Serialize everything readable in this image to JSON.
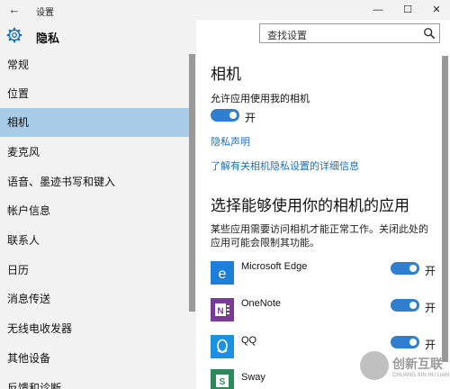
{
  "window": {
    "title": "设置",
    "back_glyph": "←",
    "min_glyph": "—",
    "max_glyph": "☐",
    "close_glyph": "✕"
  },
  "sidebar": {
    "title": "隐私",
    "items": [
      {
        "label": "常规"
      },
      {
        "label": "位置"
      },
      {
        "label": "相机"
      },
      {
        "label": "麦克风"
      },
      {
        "label": "语音、墨迹书写和键入"
      },
      {
        "label": "帐户信息"
      },
      {
        "label": "联系人"
      },
      {
        "label": "日历"
      },
      {
        "label": "消息传送"
      },
      {
        "label": "无线电收发器"
      },
      {
        "label": "其他设备"
      },
      {
        "label": "反馈和诊断"
      }
    ],
    "selected_index": 2
  },
  "search": {
    "placeholder": "查找设置"
  },
  "main": {
    "title": "相机",
    "allow_label": "允许应用使用我的相机",
    "allow_state": "开",
    "privacy_link": "隐私声明",
    "learn_more_link": "了解有关相机隐私设置的详细信息",
    "section_title": "选择能够使用你的相机的应用",
    "section_desc": "某些应用需要访问相机才能正常工作。关闭此处的应用可能会限制其功能。",
    "apps": [
      {
        "name": "Microsoft Edge",
        "state": "开",
        "icon": "edge-icon",
        "color": "#1e7fd8"
      },
      {
        "name": "OneNote",
        "state": "开",
        "icon": "onenote-icon",
        "color": "#7a3a9a"
      },
      {
        "name": "QQ",
        "state": "开",
        "icon": "qq-icon",
        "color": "#1e90e0"
      },
      {
        "name": "Sway",
        "state": "",
        "icon": "sway-icon",
        "color": "#2a8a5a"
      }
    ]
  },
  "watermark": {
    "text": "创新互联",
    "sub": "CHUANG XIN HU LIAN"
  },
  "colors": {
    "accent": "#2e7fcf",
    "selected_bg": "#a8cbe7",
    "link": "#1a6fb8"
  }
}
